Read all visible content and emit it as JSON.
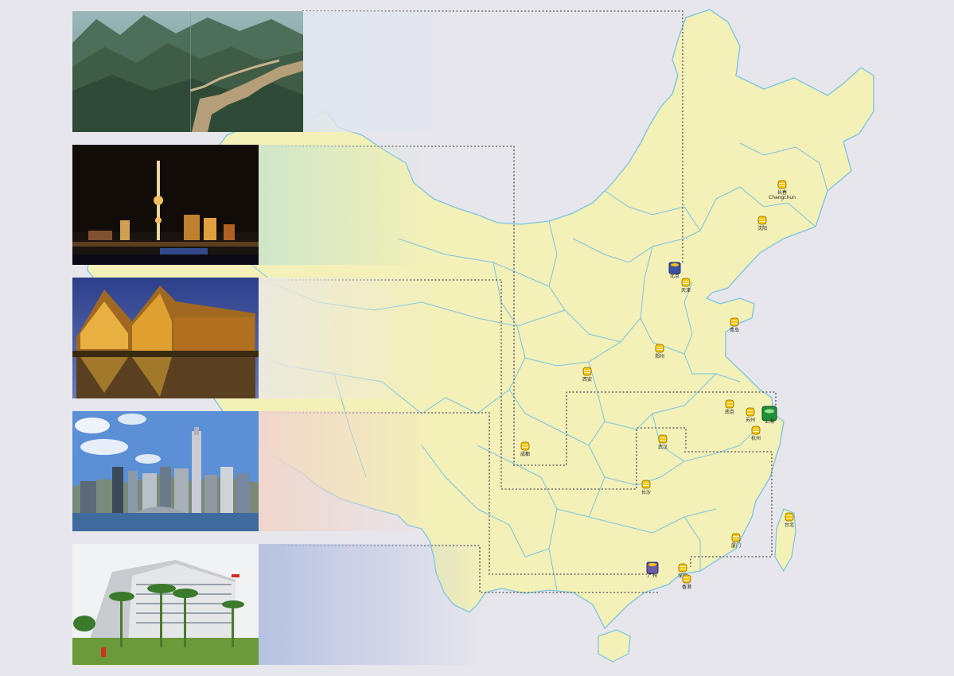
{
  "colors": {
    "background": "#e7e6ec",
    "land": "#f3f0b8",
    "border": "#79c4e2",
    "route": "#6a6a6a",
    "marker": "#f6c400",
    "hq_marker": "#1e8f3a",
    "beijing_marker": "#3a52a8",
    "guangzhou_marker": "#6e5aa2"
  },
  "photos": [
    {
      "id": "great-wall",
      "fade_color": "#dfe6f0"
    },
    {
      "id": "shanghai-night-skyline",
      "fade_color": "#cfe6c8"
    },
    {
      "id": "lit-building-reflection",
      "fade_color": "#ece9de"
    },
    {
      "id": "hong-kong-skyline",
      "fade_color": "#f0d6cc"
    },
    {
      "id": "modern-office-building",
      "fade_color": "#b7c2e2"
    }
  ],
  "cities": [
    {
      "name": "长春",
      "sub": "Changchun",
      "type": "office"
    },
    {
      "name": "沈阳",
      "type": "office"
    },
    {
      "name": "北京",
      "type": "beijing"
    },
    {
      "name": "天津",
      "type": "office"
    },
    {
      "name": "青岛",
      "type": "office"
    },
    {
      "name": "郑州",
      "type": "office"
    },
    {
      "name": "西安",
      "type": "office"
    },
    {
      "name": "南京",
      "type": "office"
    },
    {
      "name": "苏州",
      "type": "office"
    },
    {
      "name": "上海",
      "type": "hq"
    },
    {
      "name": "杭州",
      "type": "office"
    },
    {
      "name": "成都",
      "type": "office"
    },
    {
      "name": "武汉",
      "type": "office"
    },
    {
      "name": "长沙",
      "type": "office"
    },
    {
      "name": "厦门",
      "type": "office"
    },
    {
      "name": "台北",
      "type": "office"
    },
    {
      "name": "广州",
      "type": "guangzhou"
    },
    {
      "name": "深圳",
      "type": "office"
    },
    {
      "name": "香港",
      "type": "office"
    }
  ]
}
